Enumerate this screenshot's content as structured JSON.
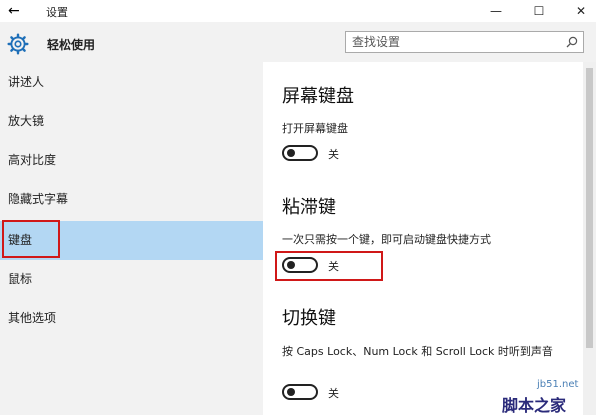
{
  "titlebar": {
    "back_glyph": "←",
    "title": "设置",
    "minimize_glyph": "—",
    "maximize_glyph": "☐",
    "close_glyph": "✕"
  },
  "sidebar": {
    "app_name": "轻松使用",
    "items": [
      {
        "label": "讲述人",
        "active": false
      },
      {
        "label": "放大镜",
        "active": false
      },
      {
        "label": "高对比度",
        "active": false
      },
      {
        "label": "隐藏式字幕",
        "active": false
      },
      {
        "label": "键盘",
        "active": true
      },
      {
        "label": "鼠标",
        "active": false
      },
      {
        "label": "其他选项",
        "active": false
      }
    ]
  },
  "search": {
    "placeholder": "查找设置"
  },
  "sections": [
    {
      "title": "屏幕键盘",
      "desc": "打开屏幕键盘",
      "toggle_state": "关"
    },
    {
      "title": "粘滞键",
      "desc": "一次只需按一个键，即可启动键盘快捷方式",
      "toggle_state": "关"
    },
    {
      "title": "切换键",
      "desc": "按 Caps Lock、Num Lock 和 Scroll Lock 时听到声音",
      "toggle_state": "关"
    }
  ],
  "watermark": {
    "site": "jb51.net",
    "name": "脚本之家"
  },
  "colors": {
    "sidebar_bg": "#f2f2f2",
    "selected_bg": "#b3d7f3",
    "highlight_border": "#d01818",
    "accent": "#1e6fb8"
  }
}
